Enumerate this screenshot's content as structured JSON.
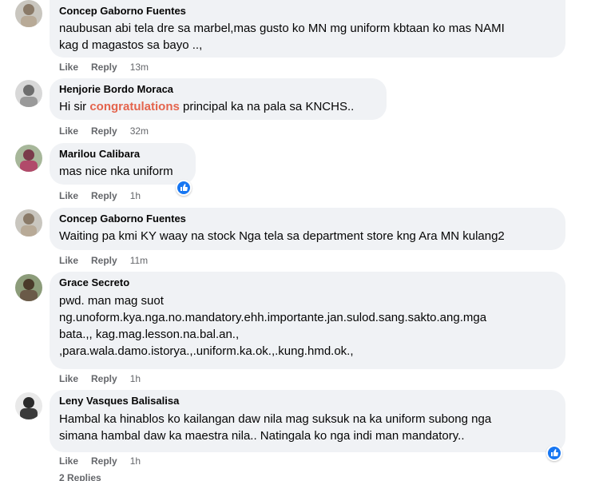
{
  "comments": [
    {
      "author": "Concep Gaborno Fuentes",
      "text": "naubusan abi tela dre sa marbel,mas gusto ko MN mg uniform kbtaan ko mas NAMI\nkag d magastos sa bayo ..,",
      "like": "Like",
      "reply": "Reply",
      "time": "13m"
    },
    {
      "author": "Henjorie Bordo Moraca",
      "text_pre": "Hi sir ",
      "text_highlight": "congratulations",
      "text_post": " principal ka na pala sa KNCHS..",
      "like": "Like",
      "reply": "Reply",
      "time": "32m"
    },
    {
      "author": "Marilou Calibara",
      "text": "mas nice nka uniform",
      "like": "Like",
      "reply": "Reply",
      "time": "1h"
    },
    {
      "author": "Concep Gaborno Fuentes",
      "text": "Waiting pa kmi KY waay na stock Nga tela sa department store kng Ara MN kulang2",
      "like": "Like",
      "reply": "Reply",
      "time": "11m"
    },
    {
      "author": "Grace Secreto",
      "text": "pwd. man mag suot\nng.unoform.kya.nga.no.mandatory.ehh.importante.jan.sulod.sang.sakto.ang.mga\nbata.,, kag.mag.lesson.na.bal.an.,\n,para.wala.damo.istorya.,.uniform.ka.ok.,.kung.hmd.ok.,",
      "like": "Like",
      "reply": "Reply",
      "time": "1h"
    },
    {
      "author": "Leny Vasques Balisalisa",
      "text": "Hambal ka hinablos ko kailangan daw nila mag suksuk na ka uniform subong nga\nsimana hambal daw ka maestra nila.. Natingala ko nga indi man mandatory..",
      "like": "Like",
      "reply": "Reply",
      "time": "1h"
    }
  ],
  "footer_partial": "2 Replies",
  "colors": {
    "bubble": "#f0f2f5",
    "highlight": "#e4644d",
    "meta": "#65676b",
    "like_blue": "#1877f2"
  }
}
